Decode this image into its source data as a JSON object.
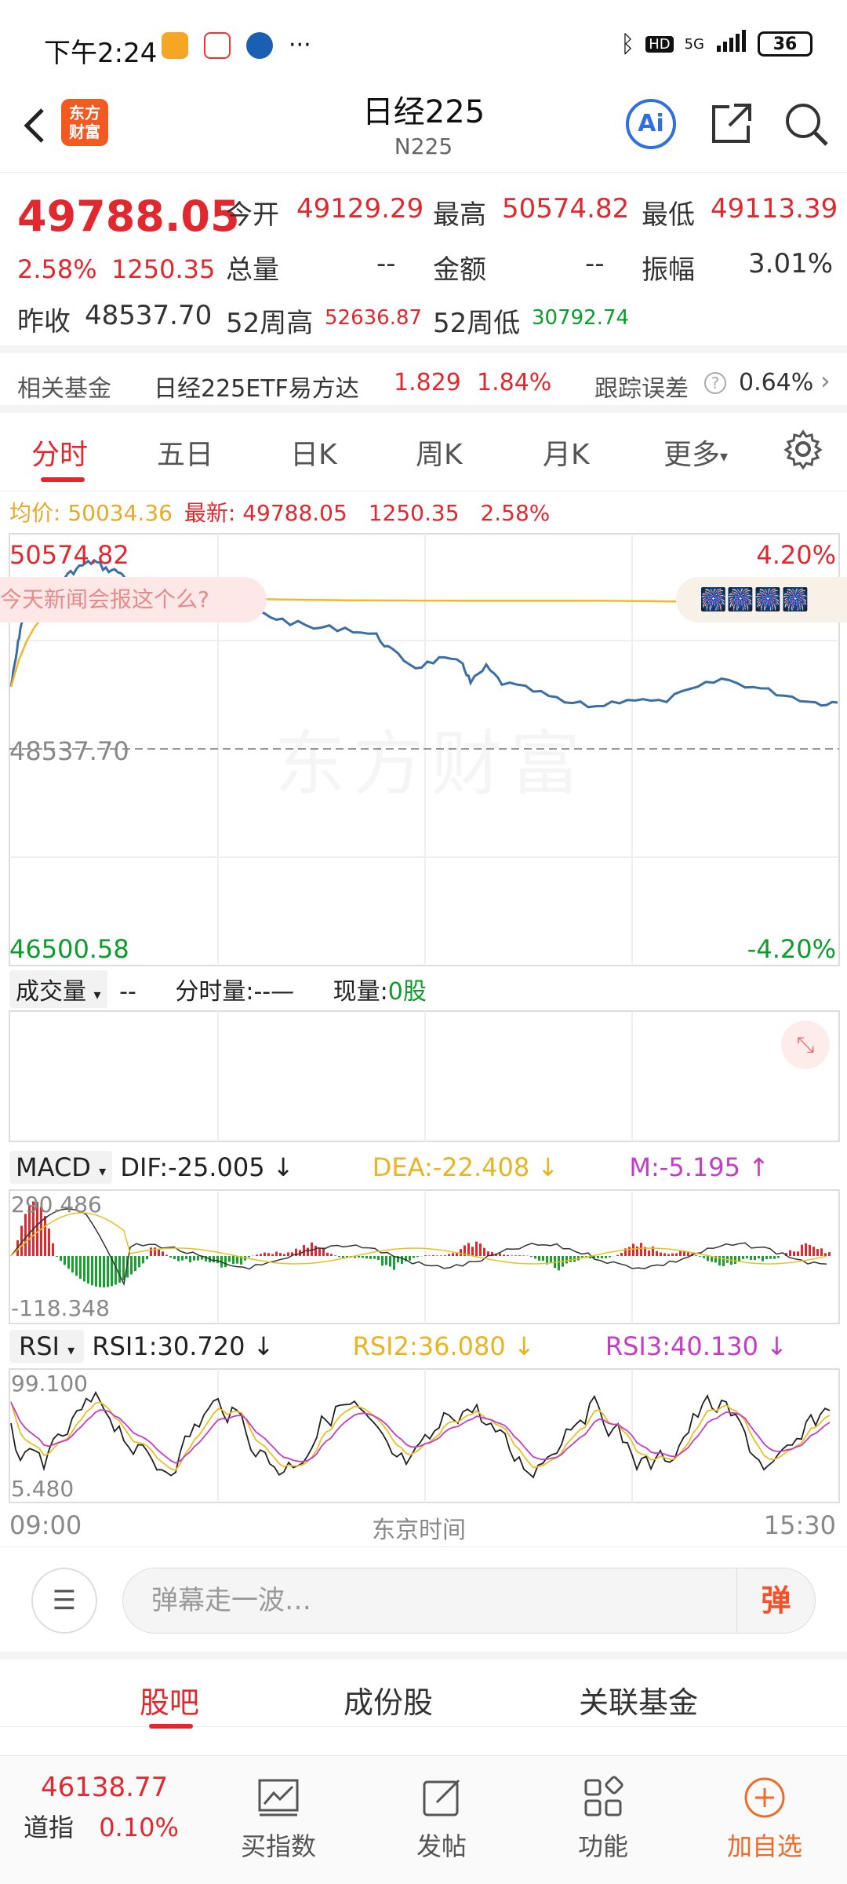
{
  "status_bar": {
    "time": "下午2:24",
    "battery": "36",
    "network": "5G",
    "hd": "HD"
  },
  "header": {
    "title": "日经225",
    "code": "N225",
    "logo_text": "东方\n财富"
  },
  "quote": {
    "price": "49788.05",
    "change_pct": "2.58%",
    "change": "1250.35",
    "open_label": "今开",
    "open": "49129.29",
    "high_label": "最高",
    "high": "50574.82",
    "low_label": "最低",
    "low": "49113.39",
    "volume_label": "总量",
    "volume": "--",
    "amount_label": "金额",
    "amount": "--",
    "amplitude_label": "振幅",
    "amplitude": "3.01%",
    "prev_close_label": "昨收",
    "prev_close": "48537.70",
    "w52_high_label": "52周高",
    "w52_high": "52636.87",
    "w52_low_label": "52周低",
    "w52_low": "30792.74"
  },
  "fund": {
    "label": "相关基金",
    "name": "日经225ETF易方达",
    "price": "1.829",
    "pct": "1.84%",
    "tracking_label": "跟踪误差",
    "tracking": "0.64%"
  },
  "tabs": [
    {
      "label": "分时",
      "active": true
    },
    {
      "label": "五日"
    },
    {
      "label": "日K"
    },
    {
      "label": "周K"
    },
    {
      "label": "月K"
    },
    {
      "label": "更多"
    }
  ],
  "intraday": {
    "avg_label": "均价:",
    "avg": "50034.36",
    "latest_label": "最新:",
    "latest": "49788.05",
    "change": "1250.35",
    "pct": "2.58%",
    "top_price": "50574.82",
    "top_pct": "4.20%",
    "mid_price": "48537.70",
    "bottom_price": "46500.58",
    "bottom_pct": "-4.20%",
    "bubble_text": "今天新闻会报这个么?",
    "danmu_text": "🎆🎆🎆🎆",
    "watermark": "东方财富"
  },
  "volume": {
    "dropdown": "成交量",
    "value": "--",
    "tick_label": "分时量:",
    "tick_value": "--—",
    "current_label": "现量:",
    "current_value": "0股"
  },
  "macd": {
    "dropdown": "MACD",
    "dif": "DIF:-25.005",
    "dea": "DEA:-22.408",
    "m": "M:-5.195",
    "top": "290.486",
    "bottom": "-118.348"
  },
  "rsi": {
    "dropdown": "RSI",
    "rsi1": "RSI1:30.720",
    "rsi2": "RSI2:36.080",
    "rsi3": "RSI3:40.130",
    "top": "99.100",
    "bottom": "5.480"
  },
  "time_axis": {
    "start": "09:00",
    "mid": "东京时间",
    "end": "15:30"
  },
  "danmaku": {
    "placeholder": "弹幕走一波…",
    "button": "弹"
  },
  "subtabs": [
    {
      "label": "股吧",
      "active": true
    },
    {
      "label": "成份股"
    },
    {
      "label": "关联基金"
    }
  ],
  "bottom_bar": {
    "index_value": "46138.77",
    "index_name": "道指",
    "index_pct": "0.10%",
    "items": [
      {
        "label": "买指数",
        "icon": "chart-icon"
      },
      {
        "label": "发帖",
        "icon": "edit-icon"
      },
      {
        "label": "功能",
        "icon": "grid-icon"
      },
      {
        "label": "加自选",
        "icon": "add-icon"
      }
    ]
  }
}
